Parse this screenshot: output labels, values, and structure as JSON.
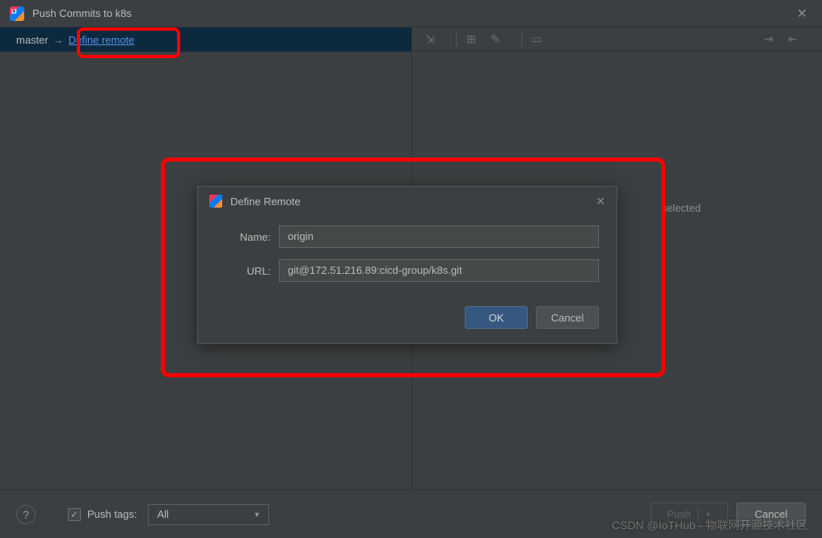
{
  "window": {
    "title": "Push Commits to k8s"
  },
  "branch": {
    "name": "master",
    "define_remote_link": "Define remote"
  },
  "right_panel": {
    "placeholder_suffix": "selected"
  },
  "modal": {
    "title": "Define Remote",
    "name_label": "Name:",
    "name_value": "origin",
    "url_label": "URL:",
    "url_value": "git@172.51.216.89:cicd-group/k8s.git",
    "ok_label": "OK",
    "cancel_label": "Cancel"
  },
  "bottom": {
    "help": "?",
    "push_tags_label": "Push tags:",
    "push_tags_checked": true,
    "dropdown_value": "All",
    "push_label": "Push",
    "cancel_label": "Cancel"
  },
  "watermark": "CSDN @IoTHub - 物联网开源技术社区"
}
